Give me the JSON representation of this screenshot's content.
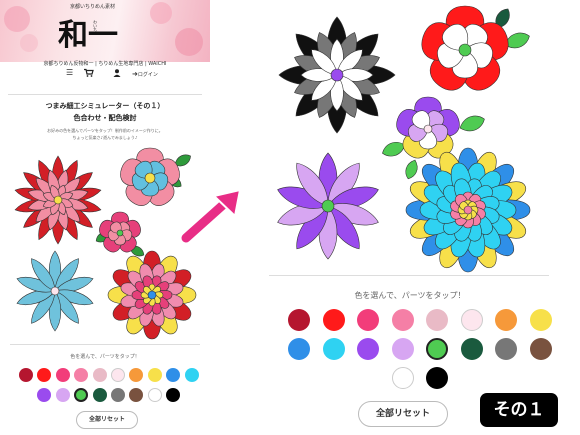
{
  "header": {
    "tagline": "京都いちりめん素材",
    "logo_text": "和一",
    "logo_sub": "わいち",
    "site_name": "京都ちりめん反物和一 | ちりめん生地専門店 | WAICHI",
    "login_label": "ログイン"
  },
  "page": {
    "title": "つまみ細工シミュレーター（その１）",
    "subtitle": "色合わせ・配色検討",
    "description_line1": "お好みの色を選んでパーツをタップ！制作前のイメージ作りに。",
    "description_line2": "ちょっと気楽さ♪遊んでみましょう♪"
  },
  "palette_prompt": "色を選んで、パーツをタップ！",
  "reset_label": "全部リセット",
  "badge_label": "その１",
  "colors": {
    "palette": [
      "#b5162f",
      "#ff1a1a",
      "#f23d7a",
      "#f57fa6",
      "#e9bac6",
      "#fde6ee",
      "#f6993a",
      "#f7e04a",
      "#2f8fe8",
      "#2fd2f2",
      "#9a4bee",
      "#d7a6f2",
      "#4fcb52",
      "#1a5a3e",
      "#777777",
      "#79523f",
      "#ffffff",
      "#000000"
    ],
    "selected": "#4fcb52"
  },
  "icons": [
    "menu-icon",
    "cart-icon",
    "user-icon",
    "login-icon",
    "arrow-icon"
  ]
}
